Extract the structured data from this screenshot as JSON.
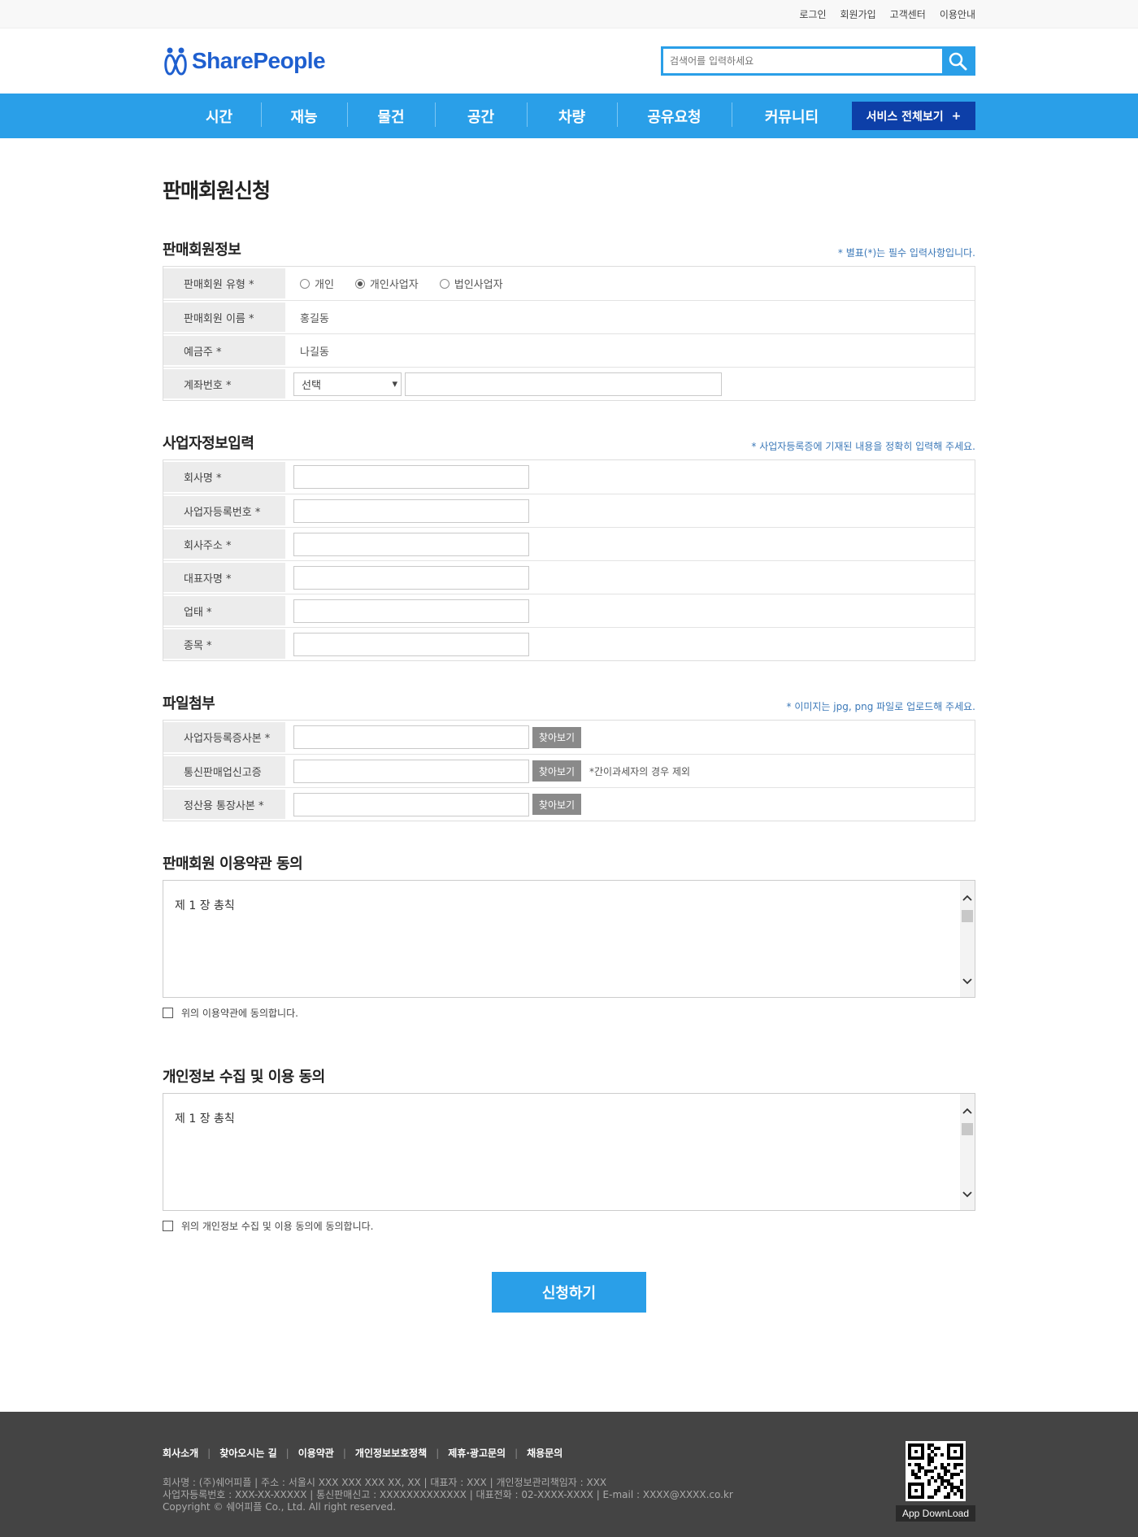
{
  "topbar": {
    "links": [
      "로그인",
      "회원가입",
      "고객센터",
      "이용안내"
    ]
  },
  "header": {
    "logo_text": "SharePeople",
    "search_placeholder": "검색어를 입력하세요"
  },
  "nav": {
    "items": [
      "시간",
      "재능",
      "물건",
      "공간",
      "차량",
      "공유요청",
      "커뮤니티"
    ],
    "all_services_label": "서비스 전체보기",
    "all_services_plus": "+"
  },
  "page": {
    "title": "판매회원신청"
  },
  "seller_info": {
    "title": "판매회원정보",
    "note": "* 별표(*)는 필수 입력사항입니다.",
    "type_label": "판매회원 유형 *",
    "type_options": [
      "개인",
      "개인사업자",
      "법인사업자"
    ],
    "type_selected": "개인사업자",
    "name_label": "판매회원 이름 *",
    "name_value": "홍길동",
    "holder_label": "예금주 *",
    "holder_value": "나길동",
    "account_label": "계좌번호 *",
    "bank_select_value": "선택",
    "select_arrow": "▾"
  },
  "business_info": {
    "title": "사업자정보입력",
    "note": "* 사업자등록증에 기재된 내용을 정확히 입력해 주세요.",
    "fields": [
      "회사명 *",
      "사업자등록번호 *",
      "회사주소 *",
      "대표자명 *",
      "업태 *",
      "종목 *"
    ]
  },
  "attachments": {
    "title": "파일첨부",
    "note": "* 이미지는 jpg, png 파일로 업로드해 주세요.",
    "fields": [
      "사업자등록증사본 *",
      "통신판매업신고증",
      "정산용 통장사본 *"
    ],
    "find_label": "찾아보기",
    "telecom_note": "*간이과세자의 경우 제외"
  },
  "terms": {
    "title": "판매회원 이용약관 동의",
    "content": "제 1 장 총칙",
    "agree_label": "위의 이용약관에 동의합니다."
  },
  "privacy": {
    "title": "개인정보 수집 및 이용 동의",
    "content": "제 1 장 총칙",
    "agree_label": "위의 개인정보 수집 및 이용 동의에 동의합니다."
  },
  "submit_label": "신청하기",
  "footer": {
    "links": [
      "회사소개",
      "찾아오시는 길",
      "이용약관",
      "개인정보보호정책",
      "제휴·광고문의",
      "채용문의"
    ],
    "info_line1": "회사명 : (주)쉐어피플  |  주소 : 서울시 XXX XXX XXX XX, XX  |  대표자 : XXX  |  개인정보관리책임자 : XXX",
    "info_line2": "사업자등록번호 : XXX-XX-XXXXX  | 통신판매신고 : XXXXXXXXXXXXX  | 대표전화 : 02-XXXX-XXXX  |  E-mail : XXXX@XXXX.co.kr",
    "info_line3": "Copyright © 쉐어피플 Co., Ltd. All right reserved.",
    "app_download": "App DownLoad"
  },
  "colors": {
    "primary": "#2a9fe8",
    "dark_blue": "#0d3fa8",
    "logo": "#1e5fcf",
    "footer_bg": "#444444"
  }
}
